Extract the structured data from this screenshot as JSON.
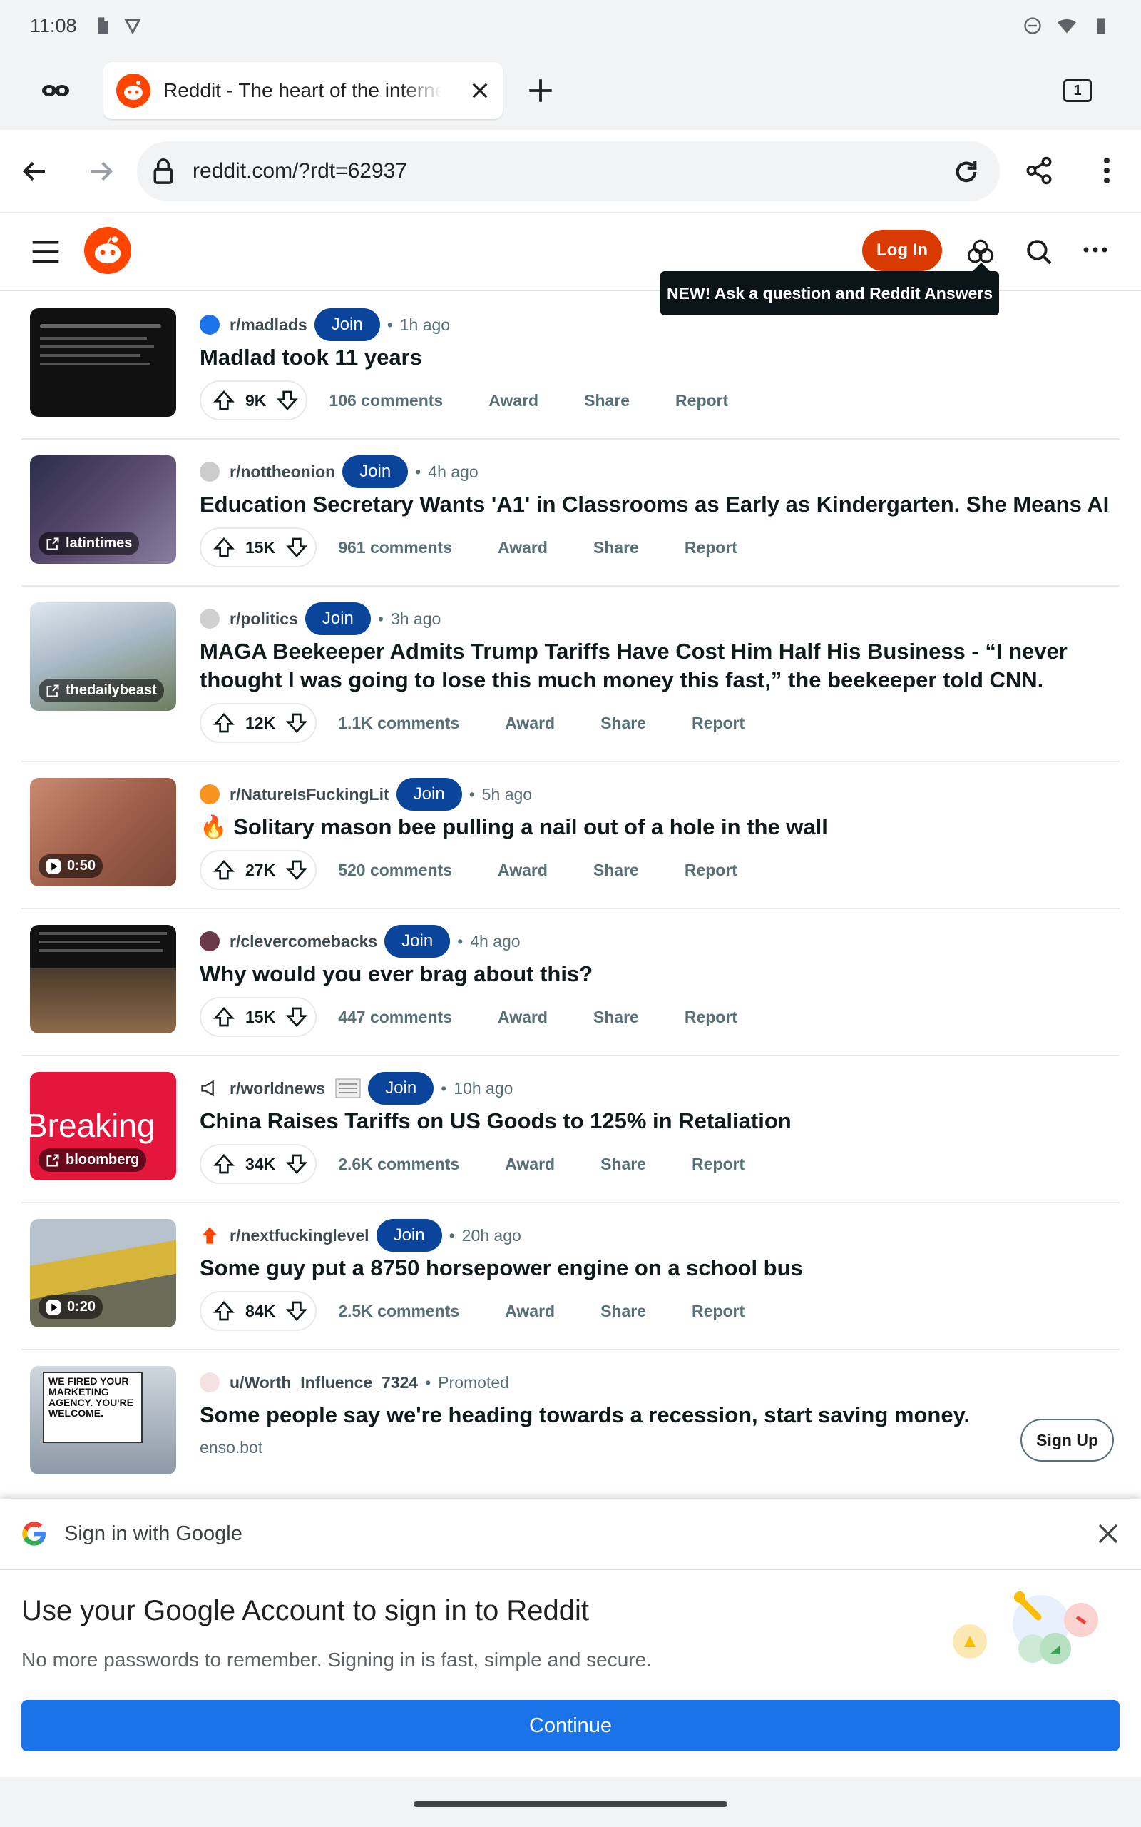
{
  "status_bar": {
    "time": "11:08"
  },
  "browser": {
    "tab_title": "Reddit - The heart of the internet",
    "tab_count": "1",
    "url": "reddit.com/?rdt=62937"
  },
  "reddit_header": {
    "login_label": "Log In",
    "tooltip": "NEW! Ask a question and Reddit Answers"
  },
  "posts": [
    {
      "sub": "r/madlads",
      "join": "Join",
      "ago": "1h ago",
      "title": "Madlad took 11 years",
      "votes": "9K",
      "comments": "106 comments",
      "award": "Award",
      "share": "Share",
      "report": "Report",
      "thumb_badge": ""
    },
    {
      "sub": "r/nottheonion",
      "join": "Join",
      "ago": "4h ago",
      "title": "Education Secretary Wants 'A1' in Classrooms as Early as Kindergarten. She Means AI",
      "votes": "15K",
      "comments": "961 comments",
      "award": "Award",
      "share": "Share",
      "report": "Report",
      "thumb_badge": "latintimes"
    },
    {
      "sub": "r/politics",
      "join": "Join",
      "ago": "3h ago",
      "title": "MAGA Beekeeper Admits Trump Tariffs Have Cost Him Half His Business - “I never thought I was going to lose this much money this fast,” the beekeeper told CNN.",
      "votes": "12K",
      "comments": "1.1K comments",
      "award": "Award",
      "share": "Share",
      "report": "Report",
      "thumb_badge": "thedailybeast"
    },
    {
      "sub": "r/NatureIsFuckingLit",
      "join": "Join",
      "ago": "5h ago",
      "title": "🔥 Solitary mason bee pulling a nail out of a hole in the wall",
      "votes": "27K",
      "comments": "520 comments",
      "award": "Award",
      "share": "Share",
      "report": "Report",
      "thumb_badge": "0:50"
    },
    {
      "sub": "r/clevercomebacks",
      "join": "Join",
      "ago": "4h ago",
      "title": "Why would you ever brag about this?",
      "votes": "15K",
      "comments": "447 comments",
      "award": "Award",
      "share": "Share",
      "report": "Report",
      "thumb_badge": ""
    },
    {
      "sub": "r/worldnews",
      "join": "Join",
      "ago": "10h ago",
      "title": "China Raises Tariffs on US Goods to 125% in Retaliation",
      "votes": "34K",
      "comments": "2.6K comments",
      "award": "Award",
      "share": "Share",
      "report": "Report",
      "thumb_badge": "bloomberg",
      "thumb_text": "Breaking"
    },
    {
      "sub": "r/nextfuckinglevel",
      "join": "Join",
      "ago": "20h ago",
      "title": "Some guy put a 8750 horsepower engine on a school bus",
      "votes": "84K",
      "comments": "2.5K comments",
      "award": "Award",
      "share": "Share",
      "report": "Report",
      "thumb_badge": "0:20"
    }
  ],
  "promoted": {
    "user": "u/Worth_Influence_7324",
    "label": "Promoted",
    "title": "Some people say we're heading towards a recession, start saving money.",
    "domain": "enso.bot",
    "cta": "Sign Up",
    "thumb_text": "WE FIRED YOUR MARKETING AGENCY. YOU'RE WELCOME."
  },
  "google_signin": {
    "header": "Sign in with Google",
    "headline": "Use your Google Account to sign in to Reddit",
    "subtext": "No more passwords to remember. Signing in is fast, simple and secure.",
    "continue_label": "Continue"
  },
  "colors": {
    "reddit_orange": "#ff4500",
    "join_blue": "#0a449b",
    "google_blue": "#1a73e8"
  }
}
